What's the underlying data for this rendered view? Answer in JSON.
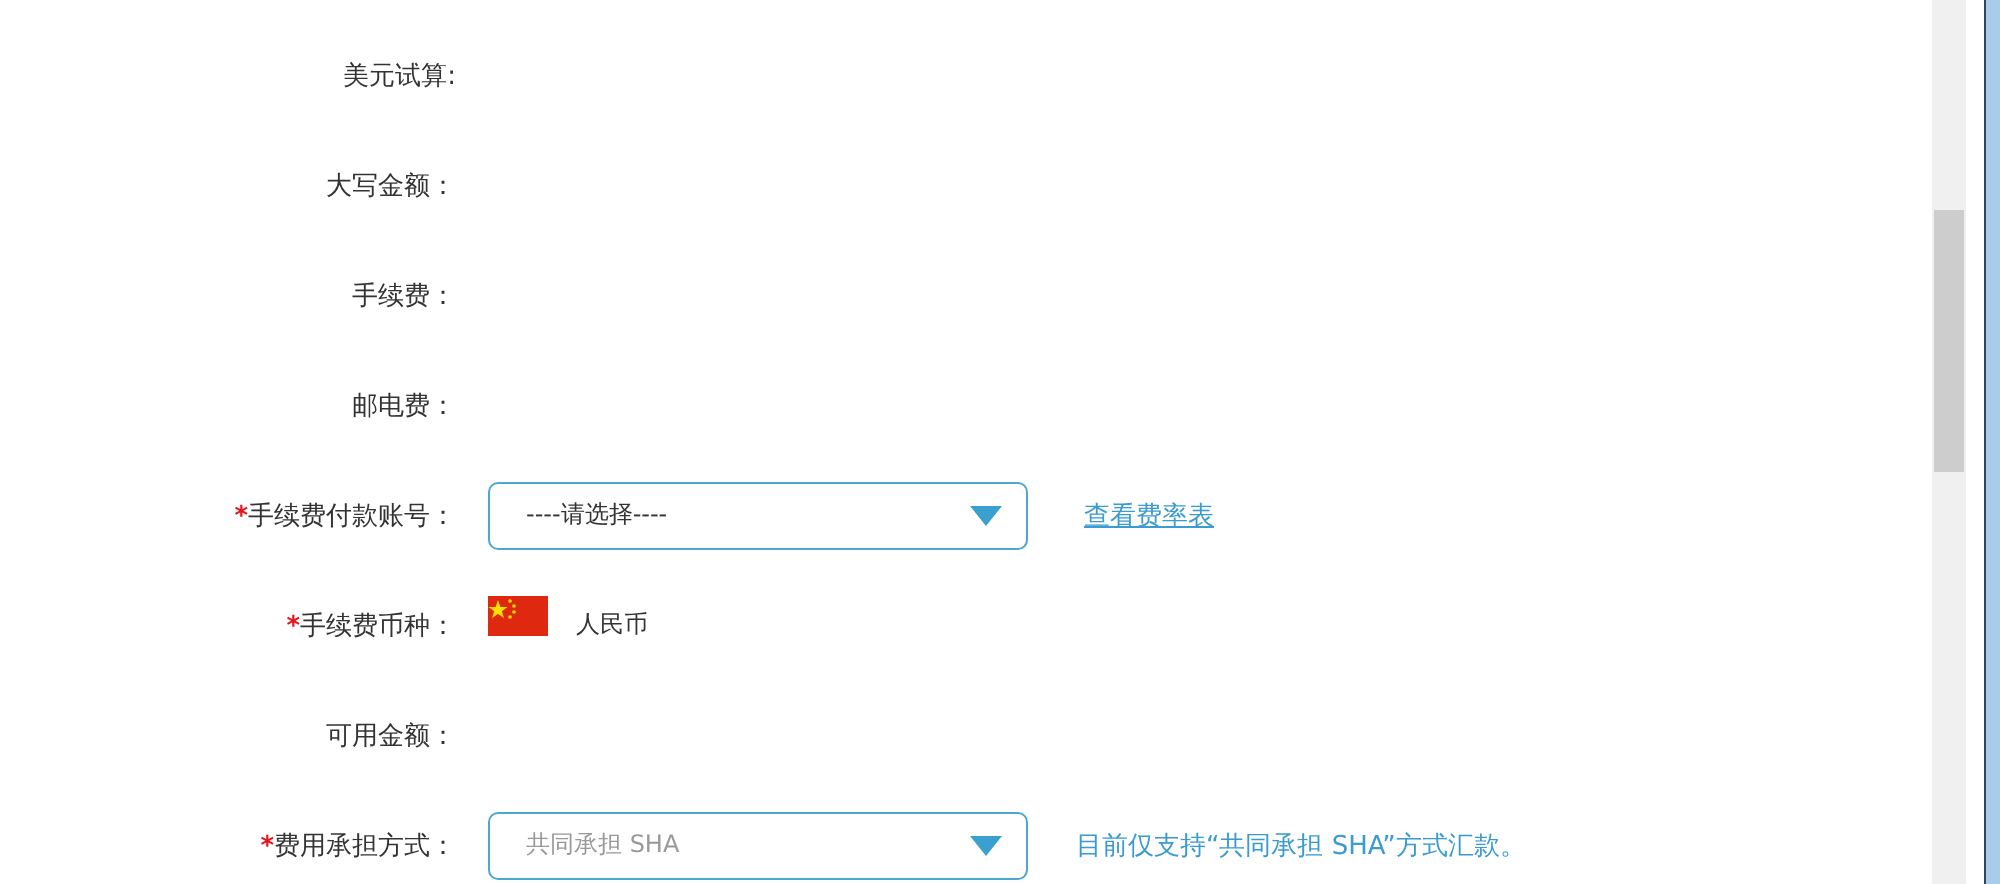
{
  "rows": [
    {
      "kind": "plain",
      "label": "美元试算:"
    },
    {
      "kind": "plain",
      "label": "大写金额："
    },
    {
      "kind": "plain",
      "label": "手续费："
    },
    {
      "kind": "plain",
      "label": "邮电费："
    },
    {
      "kind": "select",
      "label": "手续费付款账号：",
      "marker": "*",
      "value": "----请选择----",
      "disabled": false,
      "link": "查看费率表"
    },
    {
      "kind": "currency",
      "label": "手续费币种：",
      "marker": "*",
      "value": "人民币"
    },
    {
      "kind": "plain",
      "label": "可用金额："
    },
    {
      "kind": "select",
      "label": "费用承担方式：",
      "marker": "*",
      "value": "共同承担 SHA",
      "disabled": true,
      "note": "目前仅支持“共同承担 SHA”方式汇款。"
    }
  ]
}
